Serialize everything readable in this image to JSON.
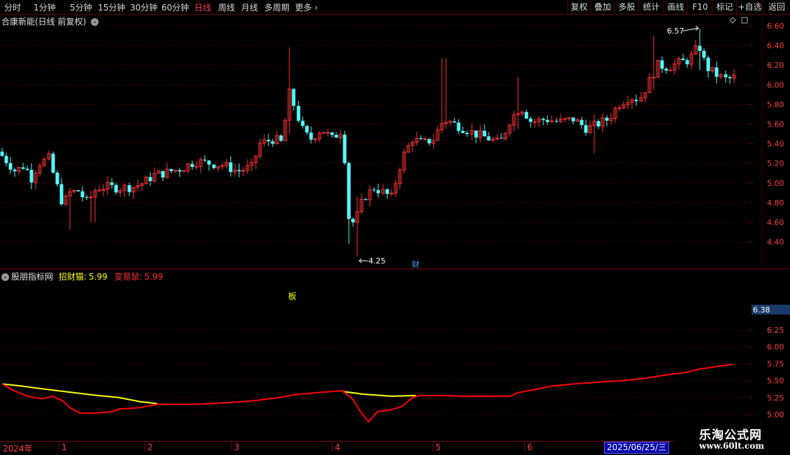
{
  "topbar": {
    "periods": [
      "分时",
      "1分钟",
      "5分钟",
      "15分钟",
      "30分钟",
      "60分钟",
      "日线",
      "周线",
      "月线",
      "多周期",
      "更多"
    ],
    "active_period": "日线",
    "right_buttons": [
      "复权",
      "叠加",
      "多股",
      "统计",
      "画线",
      "F10",
      "标记",
      "+自选",
      "返回"
    ]
  },
  "main_chart": {
    "title": "合康新能(日线 前复权)",
    "price_ticks": [
      "6.60",
      "6.40",
      "6.20",
      "6.00",
      "5.80",
      "5.60",
      "5.40",
      "5.20",
      "5.00",
      "4.80",
      "4.60",
      "4.40"
    ],
    "high_marker": "6.57",
    "low_marker": "4.25",
    "event_marker": "财"
  },
  "indicator": {
    "name": "股朋指标网",
    "line1_label": "招财猫:",
    "line1_value": "5.99",
    "line2_label": "变易鼠:",
    "line2_value": "5.99",
    "signal_text": "板",
    "axis_ticks": [
      "6.25",
      "6.00",
      "5.75",
      "5.50",
      "5.25",
      "5.00"
    ],
    "current_value": "6.38"
  },
  "date_axis": {
    "labels": [
      "2024年",
      "1",
      "2",
      "3",
      "4",
      "5",
      "6"
    ],
    "cursor_date": "2025/06/25/三"
  },
  "watermark": {
    "line1": "乐淘公式网",
    "line2": "www.60lt.com"
  },
  "colors": {
    "up": "#ff3232",
    "down": "#54fcfc",
    "yellow_line": "#ffff00",
    "red_line": "#ff0000",
    "grid": "#7a0000",
    "text_red": "#ff4040"
  }
}
